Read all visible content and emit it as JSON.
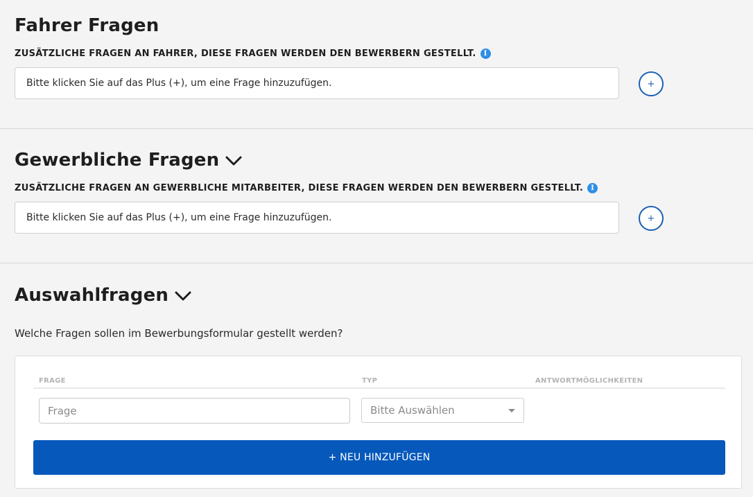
{
  "fahrer": {
    "title": "Fahrer Fragen",
    "subtitle": "Zusätzliche Fragen an Fahrer, diese Fragen werden den Bewerbern gestellt.",
    "placeholder_text": "Bitte klicken Sie auf das Plus (+), um eine Frage hinzuzufügen.",
    "plus_label": "+"
  },
  "gewerbliche": {
    "title": "Gewerbliche Fragen",
    "subtitle": "Zusätzliche Fragen an gewerbliche Mitarbeiter, diese Fragen werden den Bewerbern gestellt.",
    "placeholder_text": "Bitte klicken Sie auf das Plus (+), um eine Frage hinzuzufügen.",
    "plus_label": "+"
  },
  "auswahl": {
    "title": "Auswahlfragen",
    "description": "Welche Fragen sollen im Bewerbungsformular gestellt werden?",
    "columns": [
      "Frage",
      "Typ",
      "Antwortmöglichkeiten"
    ],
    "frage_placeholder": "Frage",
    "typ_selected": "Bitte Auswählen",
    "add_label": "+ NEU HINZUFÜGEN"
  },
  "icons": {
    "info": "info-icon",
    "chevron": "chevron-down-icon",
    "plus": "plus-icon",
    "caret": "caret-down-icon"
  },
  "colors": {
    "accent": "#0658bb",
    "plus_border": "#1b5fb4",
    "info": "#2d8fe6",
    "background": "#f4f4f4"
  }
}
